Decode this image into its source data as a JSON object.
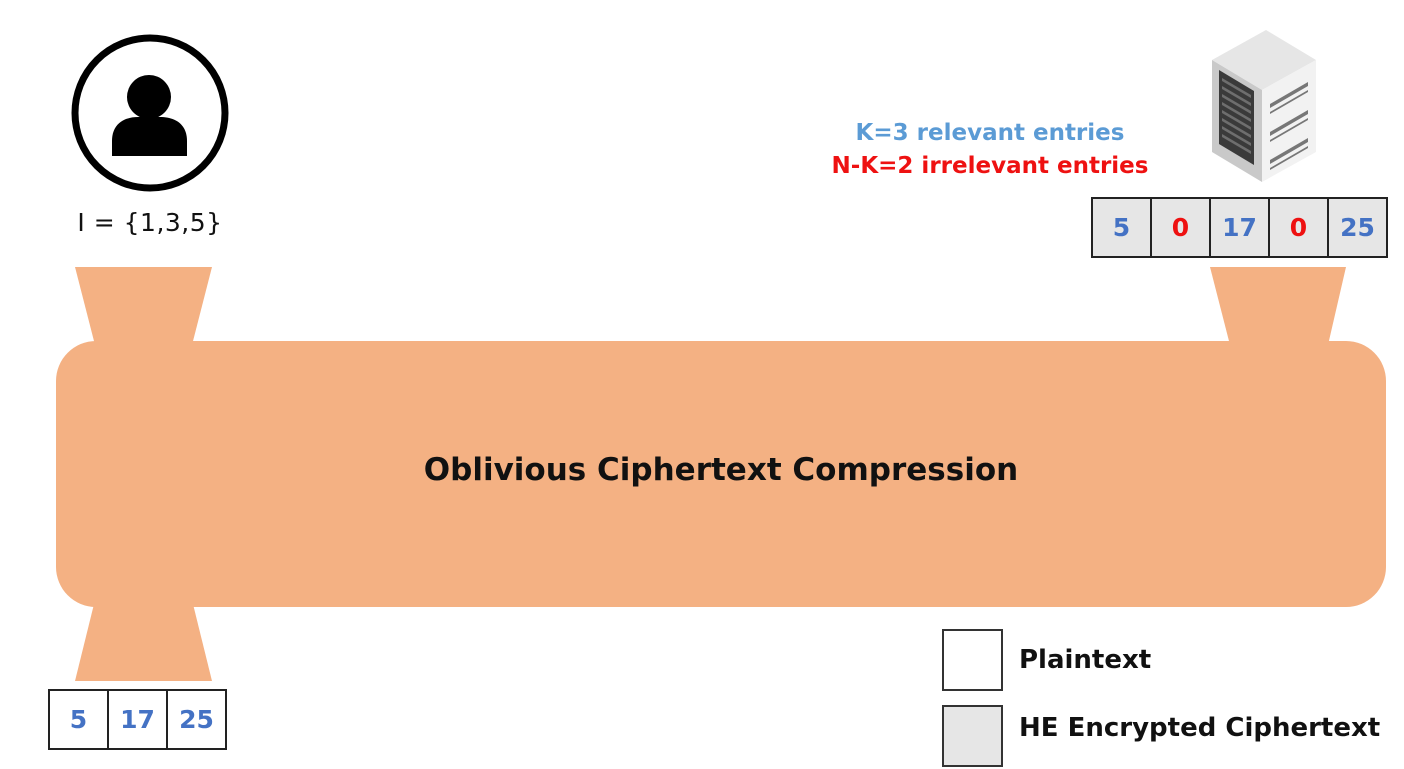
{
  "user": {
    "icon": "user-icon",
    "label": "I = {1,3,5}"
  },
  "server": {
    "icon": "server-icon",
    "relevant_text": "K=3 relevant entries",
    "irrelevant_text": "N-K=2 irrelevant entries",
    "entries": [
      {
        "value": "5",
        "relevant": true
      },
      {
        "value": "0",
        "relevant": false
      },
      {
        "value": "17",
        "relevant": true
      },
      {
        "value": "0",
        "relevant": false
      },
      {
        "value": "25",
        "relevant": true
      }
    ]
  },
  "compression": {
    "label": "Oblivious Ciphertext Compression"
  },
  "output": {
    "entries": [
      "5",
      "17",
      "25"
    ]
  },
  "legend": {
    "plaintext": "Plaintext",
    "ciphertext": "HE Encrypted Ciphertext"
  },
  "colors": {
    "band": "#f4b183",
    "relevant": "#4472c4",
    "relevant_label": "#5b9bd5",
    "irrelevant": "#ee1111",
    "ciphertext_fill": "#e6e6e6"
  }
}
